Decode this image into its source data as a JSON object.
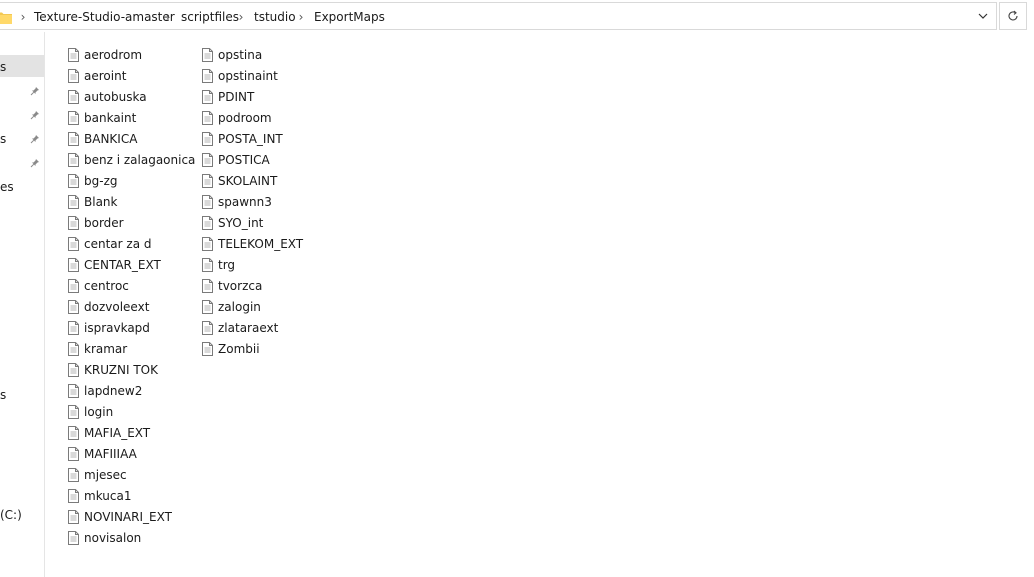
{
  "address_bar": {
    "crumbs": [
      "Texture-Studio-amaster",
      "scriptfiles",
      "tstudio",
      "ExportMaps"
    ],
    "separator": "›"
  },
  "nav_pane": {
    "fragments": [
      "s",
      "s",
      "es",
      "s",
      "(C:)"
    ]
  },
  "files": {
    "column1": [
      "aerodrom",
      "aeroint",
      "autobuska",
      "bankaint",
      "BANKICA",
      "benz i zalagaonica",
      "bg-zg",
      "Blank",
      "border",
      "centar za d",
      "CENTAR_EXT",
      "centroc",
      "dozvoleext",
      "ispravkapd",
      "kramar",
      "KRUZNI TOK",
      "lapdnew2",
      "login",
      "MAFIA_EXT",
      "MAFIIIAA",
      "mjesec",
      "mkuca1",
      "NOVINARI_EXT",
      "novisalon"
    ],
    "column2": [
      "opstina",
      "opstinaint",
      "PDINT",
      "podroom",
      "POSTA_INT",
      "POSTICA",
      "SKOLAINT",
      "spawnn3",
      "SYO_int",
      "TELEKOM_EXT",
      "trg",
      "tvorzca",
      "zalogin",
      "zlataraext",
      "Zombii"
    ]
  },
  "icons": {
    "folder": "folder-icon",
    "file": "document-icon",
    "pin": "pin-icon",
    "dropdown": "chevron-down-icon",
    "refresh": "refresh-icon"
  }
}
